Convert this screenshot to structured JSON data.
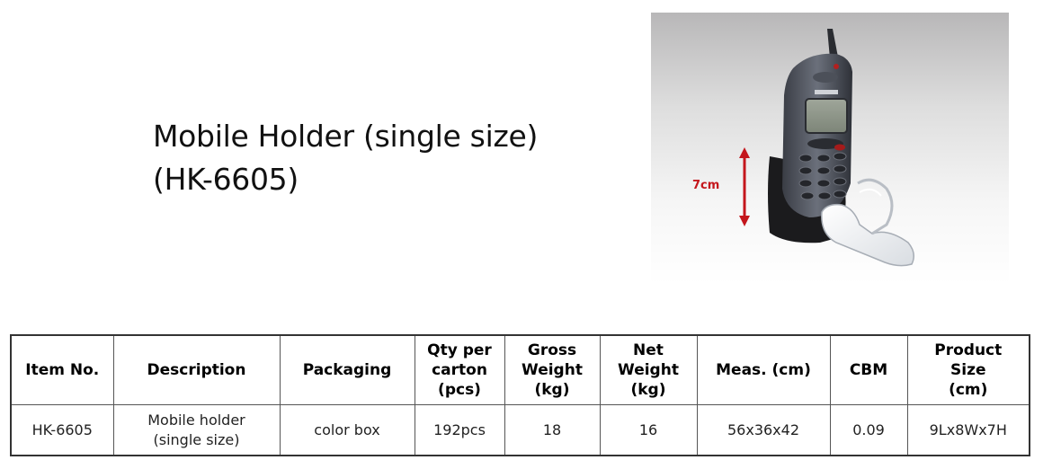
{
  "product": {
    "title_line1": "Mobile Holder (single size)",
    "title_line2": "(HK-6605)",
    "dimension_label": "7cm"
  },
  "colors": {
    "dimension_arrow": "#c4161c",
    "table_border": "#333333"
  },
  "table": {
    "headers": [
      {
        "line1": "Item No."
      },
      {
        "line1": "Description"
      },
      {
        "line1": "Packaging"
      },
      {
        "line1": "Qty per",
        "line2": "carton",
        "line3": "(pcs)"
      },
      {
        "line1": "Gross",
        "line2": "Weight",
        "line3": "(kg)"
      },
      {
        "line1": "Net",
        "line2": "Weight",
        "line3": "(kg)"
      },
      {
        "line1": "Meas. (cm)"
      },
      {
        "line1": "CBM"
      },
      {
        "line1": "Product",
        "line2": "Size",
        "line3": "(cm)"
      }
    ],
    "row": {
      "item_no": "HK-6605",
      "description_line1": "Mobile holder",
      "description_line2": "(single size)",
      "packaging": "color box",
      "qty_per_carton": "192pcs",
      "gross_weight": "18",
      "net_weight": "16",
      "meas": "56x36x42",
      "cbm": "0.09",
      "product_size": "9Lx8Wx7H"
    }
  }
}
